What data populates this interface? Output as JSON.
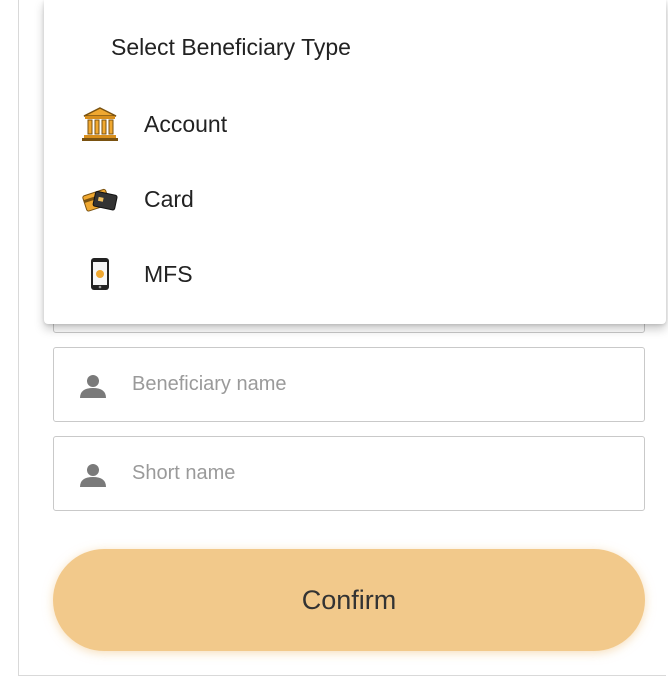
{
  "dropdown": {
    "title": "Select Beneficiary Type",
    "options": [
      {
        "label": "Account",
        "icon": "bank-icon"
      },
      {
        "label": "Card",
        "icon": "cards-icon"
      },
      {
        "label": "MFS",
        "icon": "mobile-phone-icon"
      }
    ]
  },
  "form": {
    "beneficiary_name": {
      "placeholder": "Beneficiary name",
      "value": "",
      "icon": "person-icon"
    },
    "short_name": {
      "placeholder": "Short name",
      "value": "",
      "icon": "person-icon"
    },
    "confirm_label": "Confirm"
  },
  "colors": {
    "confirm_button": "#f2c98b",
    "icon_gold": "#f0a830",
    "person_icon": "#7a7a7a"
  }
}
